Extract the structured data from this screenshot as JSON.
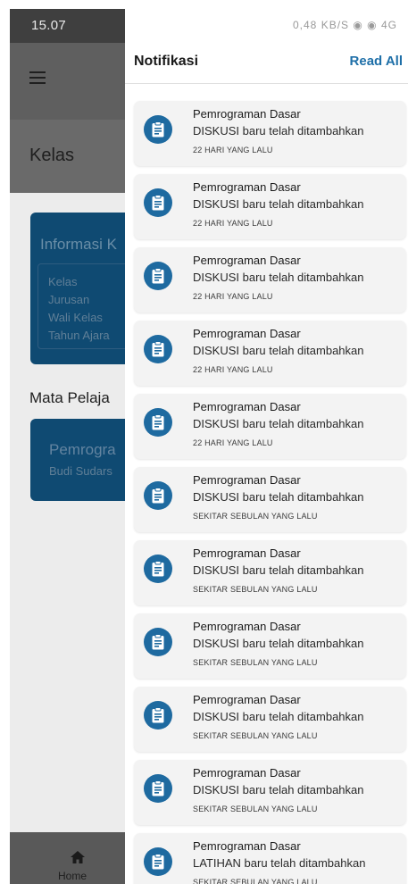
{
  "status_bar": {
    "time": "15.07",
    "icons_text": "0,48 KB/S  ◉ ◉  4G"
  },
  "background_app": {
    "page_title": "Kelas",
    "info_card": {
      "title": "Informasi K",
      "lines": [
        "Kelas",
        "Jurusan",
        "Wali Kelas",
        "Tahun Ajara"
      ]
    },
    "section_title": "Mata Pelaja",
    "subject_card": {
      "name": "Pemrogra",
      "teacher": "Budi Sudars"
    },
    "bottom_nav": {
      "home_label": "Home"
    }
  },
  "drawer": {
    "title": "Notifikasi",
    "read_all_label": "Read All",
    "notifications": [
      {
        "title": "Pemrograman Dasar",
        "message": "DISKUSI baru telah ditambahkan",
        "time": "22 HARI YANG LALU"
      },
      {
        "title": "Pemrograman Dasar",
        "message": "DISKUSI baru telah ditambahkan",
        "time": "22 HARI YANG LALU"
      },
      {
        "title": "Pemrograman Dasar",
        "message": "DISKUSI baru telah ditambahkan",
        "time": "22 HARI YANG LALU"
      },
      {
        "title": "Pemrograman Dasar",
        "message": "DISKUSI baru telah ditambahkan",
        "time": "22 HARI YANG LALU"
      },
      {
        "title": "Pemrograman Dasar",
        "message": "DISKUSI baru telah ditambahkan",
        "time": "22 HARI YANG LALU"
      },
      {
        "title": "Pemrograman Dasar",
        "message": "DISKUSI baru telah ditambahkan",
        "time": "SEKITAR SEBULAN YANG LALU"
      },
      {
        "title": "Pemrograman Dasar",
        "message": "DISKUSI baru telah ditambahkan",
        "time": "SEKITAR SEBULAN YANG LALU"
      },
      {
        "title": "Pemrograman Dasar",
        "message": "DISKUSI baru telah ditambahkan",
        "time": "SEKITAR SEBULAN YANG LALU"
      },
      {
        "title": "Pemrograman Dasar",
        "message": "DISKUSI baru telah ditambahkan",
        "time": "SEKITAR SEBULAN YANG LALU"
      },
      {
        "title": "Pemrograman Dasar",
        "message": "DISKUSI baru telah ditambahkan",
        "time": "SEKITAR SEBULAN YANG LALU"
      },
      {
        "title": "Pemrograman Dasar",
        "message": "LATIHAN baru telah ditambahkan",
        "time": "SEKITAR SEBULAN YANG LALU"
      }
    ]
  },
  "icons": {
    "menu": "menu-icon",
    "home": "home-icon",
    "notification_item": "clipboard-icon"
  },
  "colors": {
    "accent": "#1e6fa8",
    "icon_circle": "#1e6aa0",
    "card_bg": "#0f4a72"
  }
}
